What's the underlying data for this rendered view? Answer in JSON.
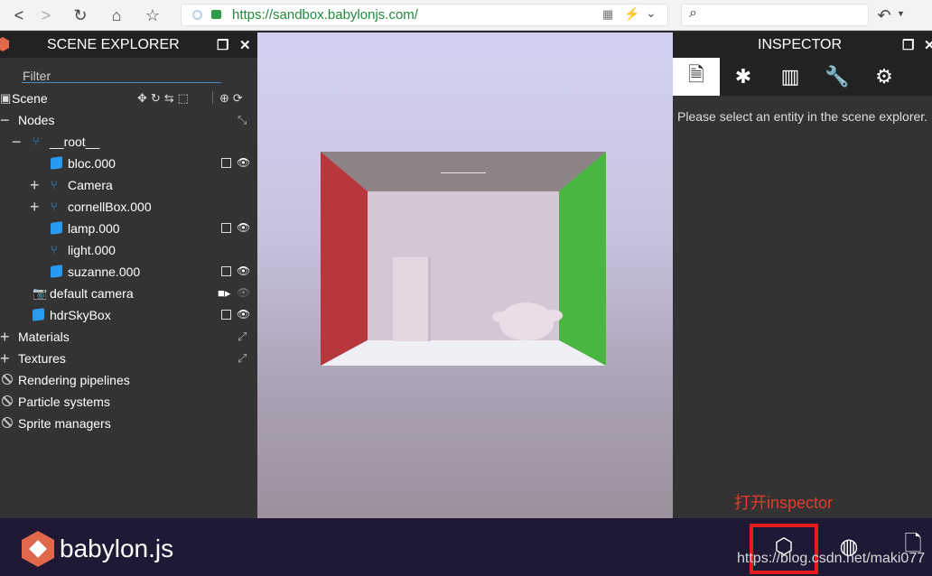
{
  "browser": {
    "url": "https://sandbox.babylonjs.com/",
    "back_icon": "<",
    "forward_icon": ">",
    "reload_icon": "↻",
    "home_icon": "⌂",
    "star_icon": "☆",
    "search_icon": "⌕",
    "undo_icon": "↶"
  },
  "scene_explorer": {
    "title": "SCENE EXPLORER",
    "filter_label": "Filter",
    "scene_label": "Scene",
    "nodes_label": "Nodes",
    "items": [
      {
        "label": "__root__",
        "icon": "branch"
      },
      {
        "label": "bloc.000",
        "icon": "mesh"
      },
      {
        "label": "Camera",
        "icon": "branch"
      },
      {
        "label": "cornellBox.000",
        "icon": "branch"
      },
      {
        "label": "lamp.000",
        "icon": "mesh"
      },
      {
        "label": "light.000",
        "icon": "branch"
      },
      {
        "label": "suzanne.000",
        "icon": "mesh"
      },
      {
        "label": "default camera",
        "icon": "camera"
      },
      {
        "label": "hdrSkyBox",
        "icon": "mesh"
      }
    ],
    "sections": [
      {
        "label": "Materials"
      },
      {
        "label": "Textures"
      },
      {
        "label": "Rendering pipelines"
      },
      {
        "label": "Particle systems"
      },
      {
        "label": "Sprite managers"
      }
    ]
  },
  "inspector": {
    "title": "INSPECTOR",
    "tabs": [
      "properties-icon",
      "debug-icon",
      "statistics-icon",
      "tools-icon",
      "settings-icon"
    ],
    "message": "Please select an entity in the scene explorer."
  },
  "annotation": "打开inspector",
  "footer": {
    "brand": "babylon.js",
    "watermark": "https://blog.csdn.net/maki077"
  },
  "colors": {
    "panel_bg": "#333333",
    "header_bg": "#222222",
    "footer_bg": "#201936",
    "accent_blue": "#2a9bf0",
    "highlight_red": "#e31c1c",
    "brand_orange": "#e0684b"
  }
}
